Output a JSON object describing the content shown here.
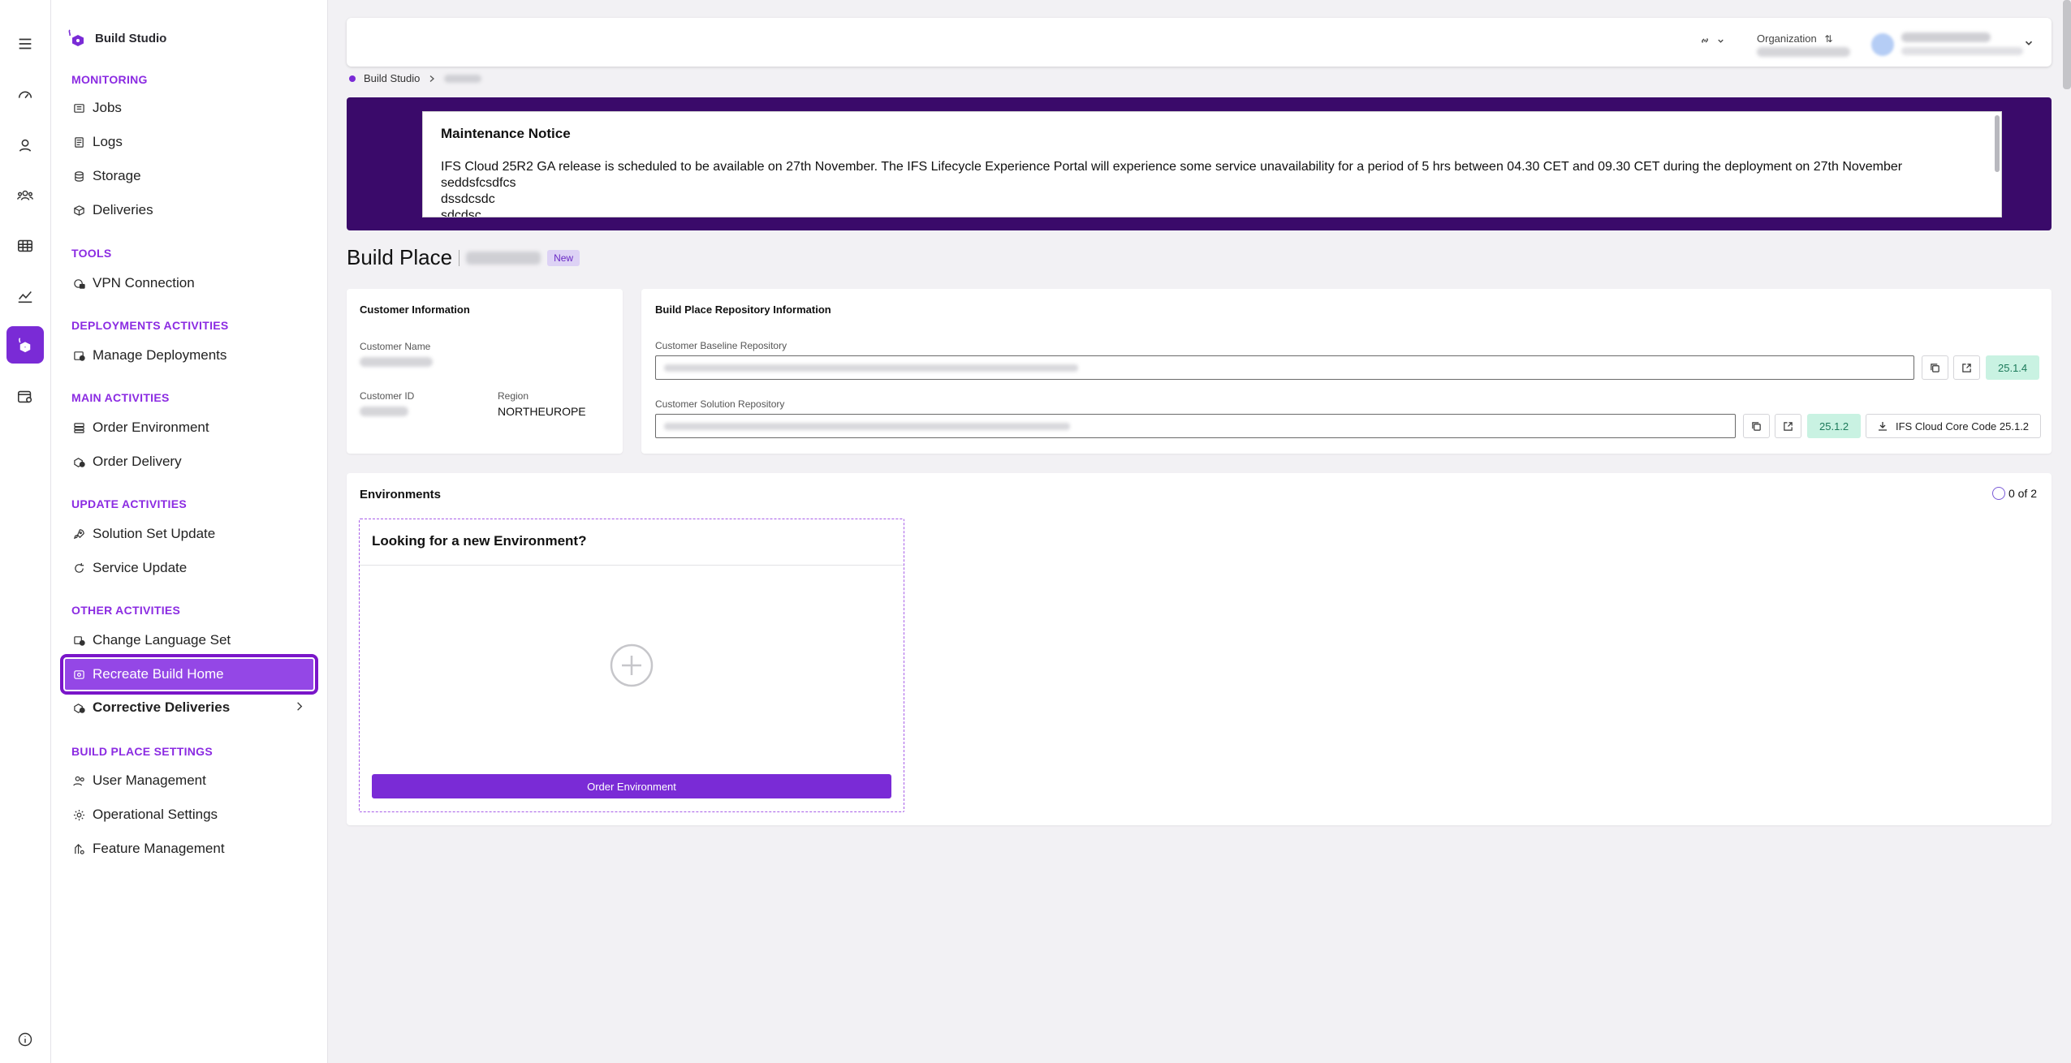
{
  "brand": {
    "name": "Build Studio"
  },
  "sidebar": {
    "sections": {
      "monitoring": "MONITORING",
      "tools": "TOOLS",
      "deployments": "DEPLOYMENTS ACTIVITIES",
      "main": "MAIN ACTIVITIES",
      "update": "UPDATE ACTIVITIES",
      "other": "OTHER ACTIVITIES",
      "settings": "BUILD PLACE SETTINGS"
    },
    "items": {
      "jobs": "Jobs",
      "logs": "Logs",
      "storage": "Storage",
      "deliveries": "Deliveries",
      "vpn": "VPN Connection",
      "manage_deployments": "Manage Deployments",
      "order_environment": "Order Environment",
      "order_delivery": "Order Delivery",
      "solution_set_update": "Solution Set Update",
      "service_update": "Service Update",
      "change_language_set": "Change Language Set",
      "recreate_build_home": "Recreate Build Home",
      "corrective_deliveries": "Corrective Deliveries",
      "user_management": "User Management",
      "operational_settings": "Operational Settings",
      "feature_management": "Feature Management"
    }
  },
  "header": {
    "organization_label": "Organization"
  },
  "breadcrumb": {
    "root": "Build Studio"
  },
  "notice": {
    "title": "Maintenance Notice",
    "line1": "IFS Cloud 25R2 GA release is scheduled to be available on 27th November. The IFS Lifecycle Experience Portal will experience some service unavailability for a period of 5 hrs between 04.30 CET and 09.30 CET during the deployment on 27th November",
    "line2": "seddsfcsdfcs",
    "line3": "dssdcsdc",
    "line4": "sdcdsc"
  },
  "page": {
    "title": "Build Place",
    "badge": "New"
  },
  "customer_info": {
    "title": "Customer Information",
    "name_label": "Customer Name",
    "id_label": "Customer ID",
    "region_label": "Region",
    "region_value": "NORTHEUROPE"
  },
  "repo_info": {
    "title": "Build Place Repository Information",
    "baseline_label": "Customer Baseline Repository",
    "baseline_version": "25.1.4",
    "solution_label": "Customer Solution Repository",
    "solution_version": "25.1.2",
    "download_label": "IFS Cloud Core Code 25.1.2"
  },
  "environments": {
    "title": "Environments",
    "count": "0 of 2",
    "new_title": "Looking for a new Environment?",
    "order_button": "Order Environment"
  },
  "colors": {
    "accent": "#7a2bd6",
    "section": "#8b2be2",
    "banner": "#3a0a6a",
    "version_badge": "#c9f2e2"
  }
}
